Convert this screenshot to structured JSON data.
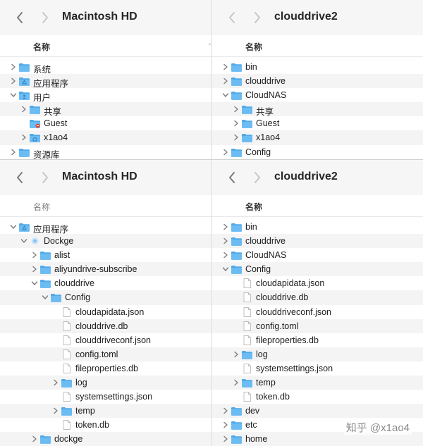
{
  "panes": {
    "tl": {
      "title": "Macintosh HD",
      "header": "名称",
      "rows": [
        {
          "depth": 0,
          "chev": "right",
          "icon": "folder",
          "label": "系统",
          "alt": false
        },
        {
          "depth": 0,
          "chev": "right",
          "icon": "apps-folder",
          "label": "应用程序",
          "alt": true
        },
        {
          "depth": 0,
          "chev": "down",
          "icon": "user-folder",
          "label": "用户",
          "alt": false
        },
        {
          "depth": 1,
          "chev": "right",
          "icon": "folder",
          "label": "共享",
          "alt": true
        },
        {
          "depth": 1,
          "chev": "none",
          "icon": "guest-folder",
          "label": "Guest",
          "alt": false
        },
        {
          "depth": 1,
          "chev": "right",
          "icon": "home-folder",
          "label": "x1ao4",
          "alt": true
        },
        {
          "depth": 0,
          "chev": "right",
          "icon": "folder",
          "label": "资源库",
          "alt": false
        }
      ]
    },
    "tr": {
      "title": "clouddrive2",
      "header": "名称",
      "rows": [
        {
          "depth": 0,
          "chev": "right",
          "icon": "folder",
          "label": "bin",
          "alt": false
        },
        {
          "depth": 0,
          "chev": "right",
          "icon": "folder",
          "label": "clouddrive",
          "alt": true
        },
        {
          "depth": 0,
          "chev": "down",
          "icon": "folder",
          "label": "CloudNAS",
          "alt": false
        },
        {
          "depth": 1,
          "chev": "right",
          "icon": "folder",
          "label": "共享",
          "alt": true
        },
        {
          "depth": 1,
          "chev": "right",
          "icon": "folder",
          "label": "Guest",
          "alt": false
        },
        {
          "depth": 1,
          "chev": "right",
          "icon": "folder",
          "label": "x1ao4",
          "alt": true
        },
        {
          "depth": 0,
          "chev": "right",
          "icon": "folder",
          "label": "Config",
          "alt": false
        }
      ]
    },
    "bl": {
      "title": "Macintosh HD",
      "header": "名称",
      "rows": [
        {
          "depth": 0,
          "chev": "down",
          "icon": "apps-folder",
          "label": "应用程序",
          "alt": false
        },
        {
          "depth": 1,
          "chev": "down",
          "icon": "app",
          "label": "Dockge",
          "alt": true
        },
        {
          "depth": 2,
          "chev": "right",
          "icon": "folder",
          "label": "alist",
          "alt": false
        },
        {
          "depth": 2,
          "chev": "right",
          "icon": "folder",
          "label": "aliyundrive-subscribe",
          "alt": true
        },
        {
          "depth": 2,
          "chev": "down",
          "icon": "folder",
          "label": "clouddrive",
          "alt": false
        },
        {
          "depth": 3,
          "chev": "down",
          "icon": "folder",
          "label": "Config",
          "alt": true
        },
        {
          "depth": 4,
          "chev": "none",
          "icon": "file",
          "label": "cloudapidata.json",
          "alt": false
        },
        {
          "depth": 4,
          "chev": "none",
          "icon": "file",
          "label": "clouddrive.db",
          "alt": true
        },
        {
          "depth": 4,
          "chev": "none",
          "icon": "file",
          "label": "clouddriveconf.json",
          "alt": false
        },
        {
          "depth": 4,
          "chev": "none",
          "icon": "file",
          "label": "config.toml",
          "alt": true
        },
        {
          "depth": 4,
          "chev": "none",
          "icon": "file",
          "label": "fileproperties.db",
          "alt": false
        },
        {
          "depth": 4,
          "chev": "right",
          "icon": "folder",
          "label": "log",
          "alt": true
        },
        {
          "depth": 4,
          "chev": "none",
          "icon": "file",
          "label": "systemsettings.json",
          "alt": false
        },
        {
          "depth": 4,
          "chev": "right",
          "icon": "folder",
          "label": "temp",
          "alt": true
        },
        {
          "depth": 4,
          "chev": "none",
          "icon": "file",
          "label": "token.db",
          "alt": false
        },
        {
          "depth": 2,
          "chev": "right",
          "icon": "folder",
          "label": "dockge",
          "alt": true
        }
      ]
    },
    "br": {
      "title": "clouddrive2",
      "header": "名称",
      "rows": [
        {
          "depth": 0,
          "chev": "right",
          "icon": "folder",
          "label": "bin",
          "alt": false
        },
        {
          "depth": 0,
          "chev": "right",
          "icon": "folder",
          "label": "clouddrive",
          "alt": true
        },
        {
          "depth": 0,
          "chev": "right",
          "icon": "folder",
          "label": "CloudNAS",
          "alt": false
        },
        {
          "depth": 0,
          "chev": "down",
          "icon": "folder",
          "label": "Config",
          "alt": true
        },
        {
          "depth": 1,
          "chev": "none",
          "icon": "file",
          "label": "cloudapidata.json",
          "alt": false
        },
        {
          "depth": 1,
          "chev": "none",
          "icon": "file",
          "label": "clouddrive.db",
          "alt": true
        },
        {
          "depth": 1,
          "chev": "none",
          "icon": "file",
          "label": "clouddriveconf.json",
          "alt": false
        },
        {
          "depth": 1,
          "chev": "none",
          "icon": "file",
          "label": "config.toml",
          "alt": true
        },
        {
          "depth": 1,
          "chev": "none",
          "icon": "file",
          "label": "fileproperties.db",
          "alt": false
        },
        {
          "depth": 1,
          "chev": "right",
          "icon": "folder",
          "label": "log",
          "alt": true
        },
        {
          "depth": 1,
          "chev": "none",
          "icon": "file",
          "label": "systemsettings.json",
          "alt": false
        },
        {
          "depth": 1,
          "chev": "right",
          "icon": "folder",
          "label": "temp",
          "alt": true
        },
        {
          "depth": 1,
          "chev": "none",
          "icon": "file",
          "label": "token.db",
          "alt": false
        },
        {
          "depth": 0,
          "chev": "right",
          "icon": "folder",
          "label": "dev",
          "alt": true
        },
        {
          "depth": 0,
          "chev": "right",
          "icon": "folder",
          "label": "etc",
          "alt": false
        },
        {
          "depth": 0,
          "chev": "right",
          "icon": "folder",
          "label": "home",
          "alt": true
        }
      ]
    }
  },
  "watermark": "知乎 @x1ao4",
  "colors": {
    "folder": "#4fa9e8",
    "folder_tab": "#6bbcf2",
    "chevron": "#7d7d7d",
    "nav": "#7a7a7a",
    "nav_disabled": "#c8c8c8"
  }
}
